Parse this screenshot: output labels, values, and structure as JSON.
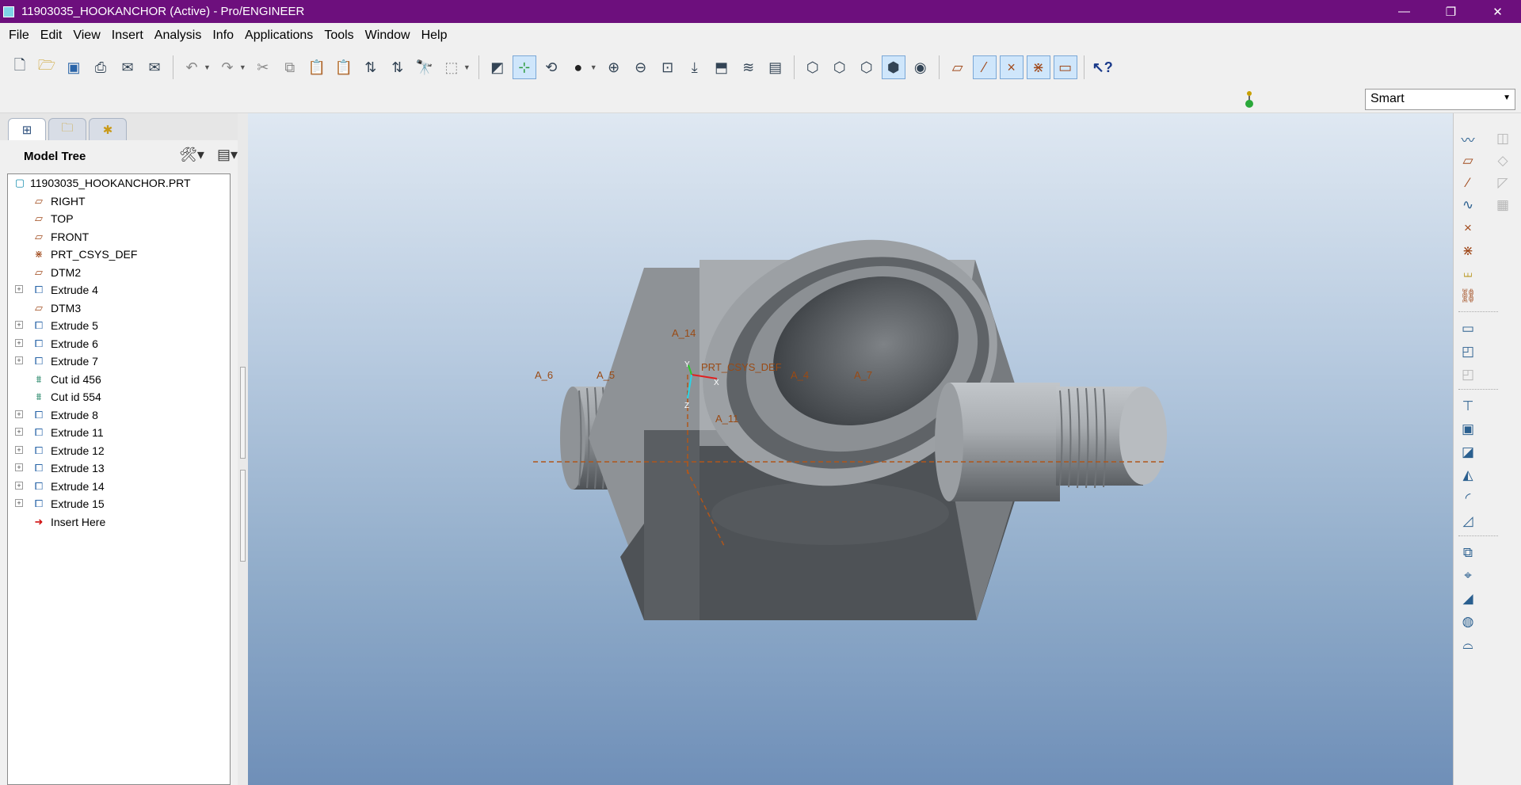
{
  "window": {
    "title": "11903035_HOOKANCHOR (Active) - Pro/ENGINEER",
    "buttons": {
      "minimize": "—",
      "restore": "❐",
      "close": "✕"
    }
  },
  "menu": [
    "File",
    "Edit",
    "View",
    "Insert",
    "Analysis",
    "Info",
    "Applications",
    "Tools",
    "Window",
    "Help"
  ],
  "toolbar": {
    "groups": [
      [
        "new-icon",
        "open-icon",
        "save-icon",
        "print-icon",
        "email-icon",
        "email-link-icon"
      ],
      [
        "undo-icon",
        "redo-icon",
        "cut-icon",
        "copy-icon",
        "paste-icon",
        "paste-special-icon",
        "regenerate-icon",
        "regen-manager-icon",
        "find-icon",
        "select-box-icon"
      ],
      [
        "repaint-icon",
        "spin-center-icon",
        "orient-mode-icon",
        "appearance-icon",
        "zoom-in-icon",
        "zoom-out-icon",
        "refit-icon",
        "reorient-icon",
        "saved-views-icon",
        "layers-icon",
        "view-manager-icon"
      ],
      [
        "wireframe-icon",
        "hidden-line-icon",
        "no-hidden-icon",
        "shading-icon",
        "enhanced-realism-icon"
      ],
      [
        "datum-planes-display-icon",
        "datum-axes-display-icon",
        "point-display-icon",
        "csys-display-icon",
        "annotation-display-icon"
      ],
      [
        "context-help-icon"
      ]
    ]
  },
  "filter": {
    "selected": "Smart"
  },
  "nav_tabs": [
    "model-tree-tab",
    "folder-browser-tab",
    "favorites-tab"
  ],
  "model_tree": {
    "header": "Model Tree",
    "items": [
      {
        "label": "11903035_HOOKANCHOR.PRT",
        "type": "part",
        "expandable": false,
        "root": true
      },
      {
        "label": "RIGHT",
        "type": "plane",
        "expandable": false
      },
      {
        "label": "TOP",
        "type": "plane",
        "expandable": false
      },
      {
        "label": "FRONT",
        "type": "plane",
        "expandable": false
      },
      {
        "label": "PRT_CSYS_DEF",
        "type": "csys",
        "expandable": false
      },
      {
        "label": "DTM2",
        "type": "plane",
        "expandable": false
      },
      {
        "label": "Extrude 4",
        "type": "extrude",
        "expandable": true
      },
      {
        "label": "DTM3",
        "type": "plane",
        "expandable": false
      },
      {
        "label": "Extrude 5",
        "type": "extrude",
        "expandable": true
      },
      {
        "label": "Extrude 6",
        "type": "extrude",
        "expandable": true
      },
      {
        "label": "Extrude 7",
        "type": "extrude",
        "expandable": true
      },
      {
        "label": "Cut id 456",
        "type": "cut",
        "expandable": false
      },
      {
        "label": "Cut id 554",
        "type": "cut",
        "expandable": false
      },
      {
        "label": "Extrude 8",
        "type": "extrude",
        "expandable": true
      },
      {
        "label": "Extrude 11",
        "type": "extrude",
        "expandable": true
      },
      {
        "label": "Extrude 12",
        "type": "extrude",
        "expandable": true
      },
      {
        "label": "Extrude 13",
        "type": "extrude",
        "expandable": true
      },
      {
        "label": "Extrude 14",
        "type": "extrude",
        "expandable": true
      },
      {
        "label": "Extrude 15",
        "type": "extrude",
        "expandable": true
      },
      {
        "label": "Insert Here",
        "type": "insert",
        "expandable": false
      }
    ]
  },
  "viewport": {
    "axis_labels": [
      "A_14",
      "A_6",
      "A_5",
      "A_4",
      "A_7",
      "A_11"
    ],
    "csys_label": "PRT_CSYS_DEF",
    "csys_axes": [
      "Y",
      "X",
      "Z"
    ]
  },
  "right_toolbar": [
    "sketched-datum-curve-icon",
    "datum-plane-icon",
    "datum-axis-icon",
    "datum-curve-icon",
    "datum-point-icon",
    "datum-csys-icon",
    "analysis-feature-icon",
    "insert-reference-icon",
    "extrude-tool-icon",
    "revolve-tool-icon",
    "variable-section-sweep-icon",
    "hole-tool-icon",
    "shell-tool-icon",
    "rib-tool-icon",
    "draft-tool-icon",
    "round-tool-icon",
    "chamfer-tool-icon",
    "pattern-tool-icon",
    "mirror-tool-icon",
    "merge-icon",
    "trim-icon",
    "extend-icon",
    "fill-icon"
  ]
}
